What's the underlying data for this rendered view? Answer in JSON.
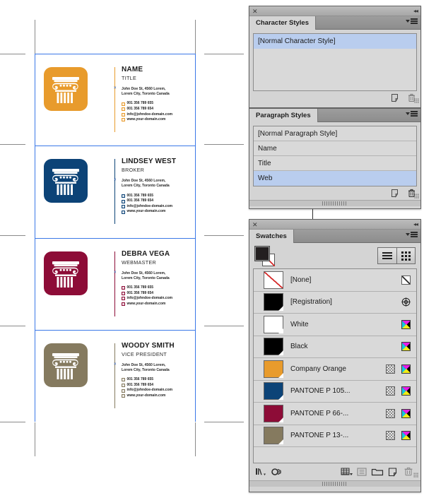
{
  "canvas": {
    "cards": [
      {
        "name": "NAME",
        "title": "TITLE",
        "address_line1": "John Doe St, 4560 Lorem,",
        "address_line2": "Lorem City, Toronto Canada",
        "phone": "001 356 789 655",
        "fax": "001 356 789 654",
        "email": "info@johndoe-domain.com",
        "web": "www.your-domain.com",
        "color": "#E89B2C",
        "marker": "x"
      },
      {
        "name": "LINDSEY WEST",
        "title": "BROKER",
        "address_line1": "John Doe St, 4560 Lorem,",
        "address_line2": "Lorem City, Toronto Canada",
        "phone": "001 356 789 655",
        "fax": "001 356 789 654",
        "email": "info@johndoe-domain.com",
        "web": "www.your-domain.com",
        "color": "#0C4377",
        "marker": "x"
      },
      {
        "name": "DEBRA VEGA",
        "title": "WEBMASTER",
        "address_line1": "John Doe St, 4560 Lorem,",
        "address_line2": "Lorem City, Toronto Canada",
        "phone": "001 356 789 655",
        "fax": "001 356 789 654",
        "email": "info@johndoe-domain.com",
        "web": "www.your-domain.com",
        "color": "#8D0C37",
        "marker": "x"
      },
      {
        "name": "WOODY SMITH",
        "title": "VICE PRESIDENT",
        "address_line1": "John Doe St, 4560 Lorem,",
        "address_line2": "Lorem City, Toronto Canada",
        "phone": "001 356 789 655",
        "fax": "001 356 789 654",
        "email": "info@johndoe-domain.com",
        "web": "www.your-domain.com",
        "color": "#857A5F",
        "marker": "x"
      }
    ],
    "frame_color": "#3B78E7",
    "guide_color": "#8A8A8A"
  },
  "character_styles_panel": {
    "tab_label": "Character Styles",
    "close_glyph": "✕",
    "collapse_glyph": "«",
    "items": [
      {
        "label": "[Normal Character Style]",
        "selected": true
      }
    ],
    "footer_icons": [
      "new-style-icon",
      "delete-icon"
    ]
  },
  "paragraph_styles_panel": {
    "tab_label": "Paragraph Styles",
    "items": [
      {
        "label": "[Normal Paragraph Style]",
        "selected": false
      },
      {
        "label": "Name",
        "selected": false
      },
      {
        "label": "Title",
        "selected": false
      },
      {
        "label": "Web",
        "selected": true
      }
    ],
    "footer_icons": [
      "new-style-icon",
      "delete-icon"
    ]
  },
  "swatches_panel": {
    "tab_label": "Swatches",
    "close_glyph": "✕",
    "collapse_glyph": "«",
    "fill_color": "#231F20",
    "stroke_color": "none",
    "view_buttons": [
      "list-view",
      "grid-view"
    ],
    "rows": [
      {
        "label": "[None]",
        "chip": "none",
        "color": "#FFFFFF",
        "tint_icon": false,
        "right_icon": "none-slash-icon"
      },
      {
        "label": "[Registration]",
        "chip": "solid",
        "color": "#000000",
        "tint_icon": false,
        "right_icon": "registration-icon"
      },
      {
        "label": "White",
        "chip": "solid",
        "color": "#FFFFFF",
        "tint_icon": false,
        "right_icon": "cmyk-icon"
      },
      {
        "label": "Black",
        "chip": "solid",
        "color": "#000000",
        "tint_icon": false,
        "right_icon": "cmyk-icon"
      },
      {
        "label": "Company Orange",
        "chip": "solid",
        "color": "#E89B2C",
        "tint_icon": true,
        "right_icon": "cmyk-icon"
      },
      {
        "label": "PANTONE P 105...",
        "chip": "solid",
        "color": "#0C4377",
        "tint_icon": true,
        "right_icon": "cmyk-icon"
      },
      {
        "label": "PANTONE P 66-...",
        "chip": "solid",
        "color": "#8D0C37",
        "tint_icon": true,
        "right_icon": "cmyk-icon"
      },
      {
        "label": "PANTONE P 13-...",
        "chip": "solid",
        "color": "#857A5F",
        "tint_icon": true,
        "right_icon": "cmyk-icon"
      }
    ],
    "footer_icons": [
      "show-all-swatches-icon",
      "show-color-groups-icon",
      "new-color-group-icon",
      "new-swatch-from-list-icon",
      "new-color-group-folder-icon",
      "new-swatch-icon",
      "delete-swatch-icon"
    ]
  }
}
